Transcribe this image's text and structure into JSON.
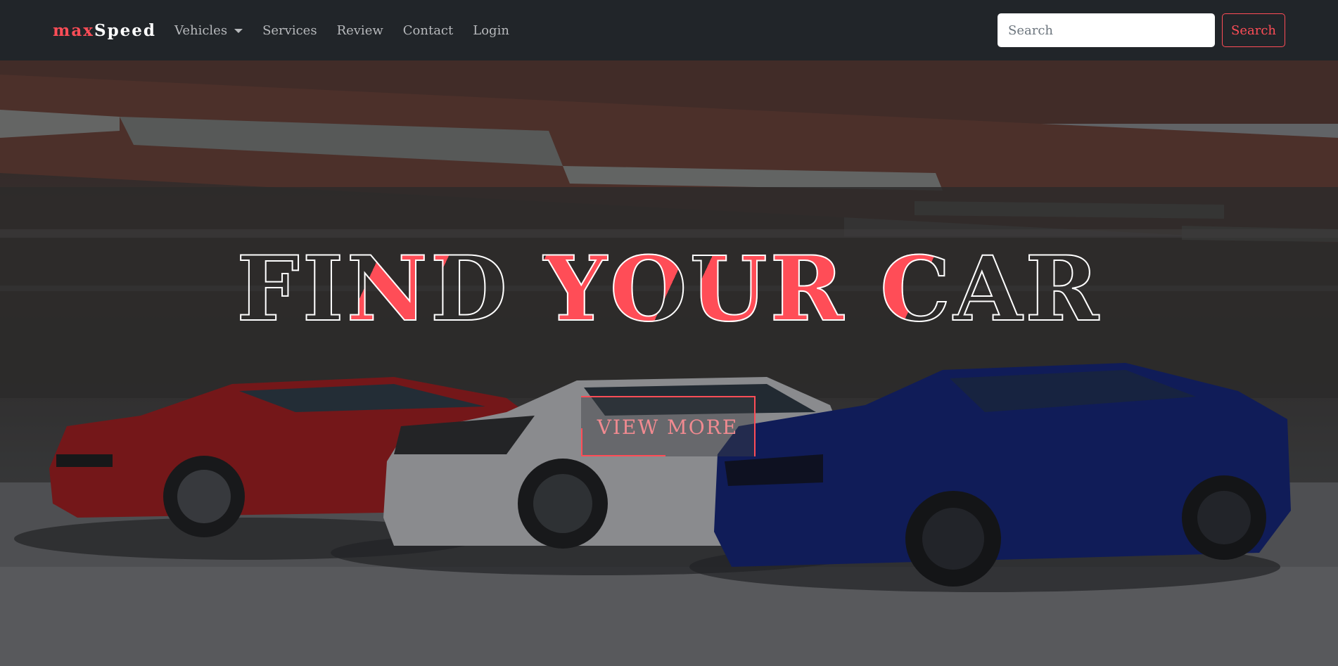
{
  "navbar": {
    "brand_part1": "max",
    "brand_part2": "Speed",
    "items": [
      {
        "label": "Vehicles",
        "has_dropdown": true
      },
      {
        "label": "Services"
      },
      {
        "label": "Review"
      },
      {
        "label": "Contact"
      },
      {
        "label": "Login"
      }
    ],
    "search_placeholder": "Search",
    "search_button": "Search"
  },
  "hero": {
    "headline": "FIND YOUR CAR",
    "cta_label": "VIEW MORE",
    "accent_color": "#ff4d57"
  }
}
